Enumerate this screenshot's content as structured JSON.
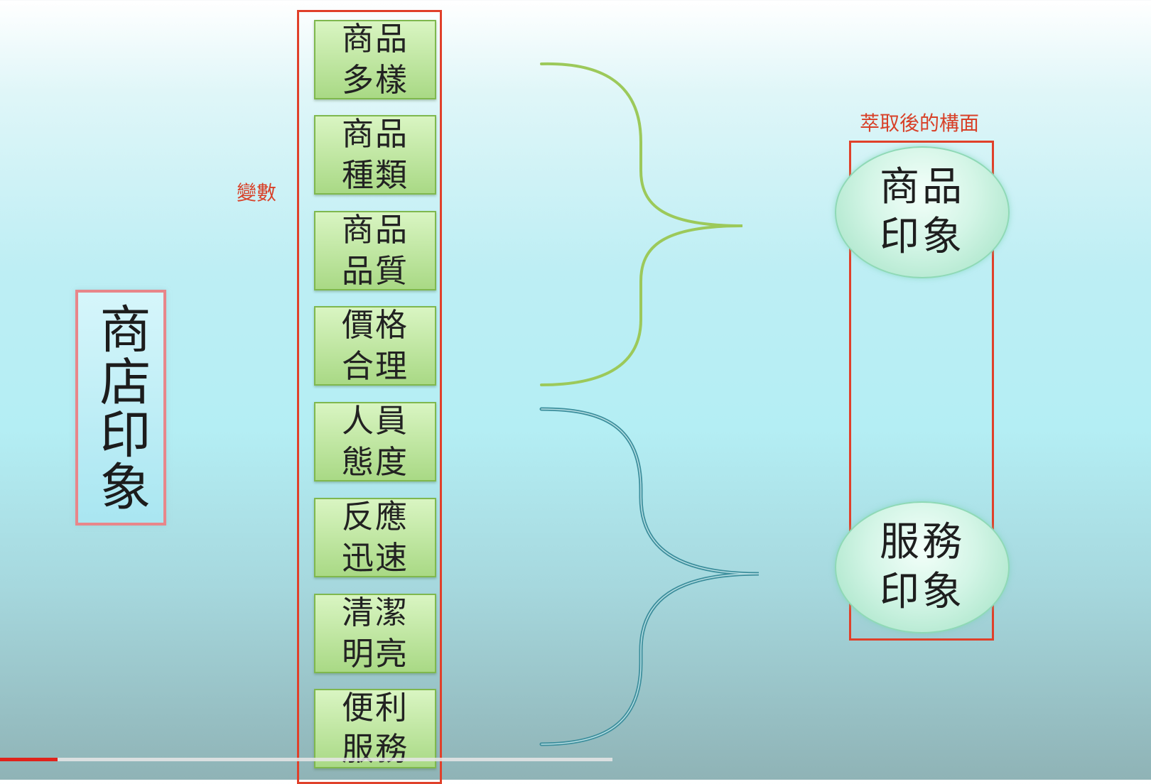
{
  "store_title": "商店印象",
  "variables_label": "變數",
  "factors_label": "萃取後的構面",
  "variables": [
    {
      "line1": "商品",
      "line2": "多樣"
    },
    {
      "line1": "商品",
      "line2": "種類"
    },
    {
      "line1": "商品",
      "line2": "品質"
    },
    {
      "line1": "價格",
      "line2": "合理"
    },
    {
      "line1": "人員",
      "line2": "態度"
    },
    {
      "line1": "反應",
      "line2": "迅速"
    },
    {
      "line1": "清潔",
      "line2": "明亮"
    },
    {
      "line1": "便利",
      "line2": "服務"
    }
  ],
  "factors": [
    {
      "line1": "商品",
      "line2": "印象"
    },
    {
      "line1": "服務",
      "line2": "印象"
    }
  ],
  "colors": {
    "annotation_red": "#e0402a",
    "brace_green": "#9cc95a",
    "brace_teal": "#3c8e9c"
  },
  "video": {
    "progress_fraction": 0.05
  }
}
